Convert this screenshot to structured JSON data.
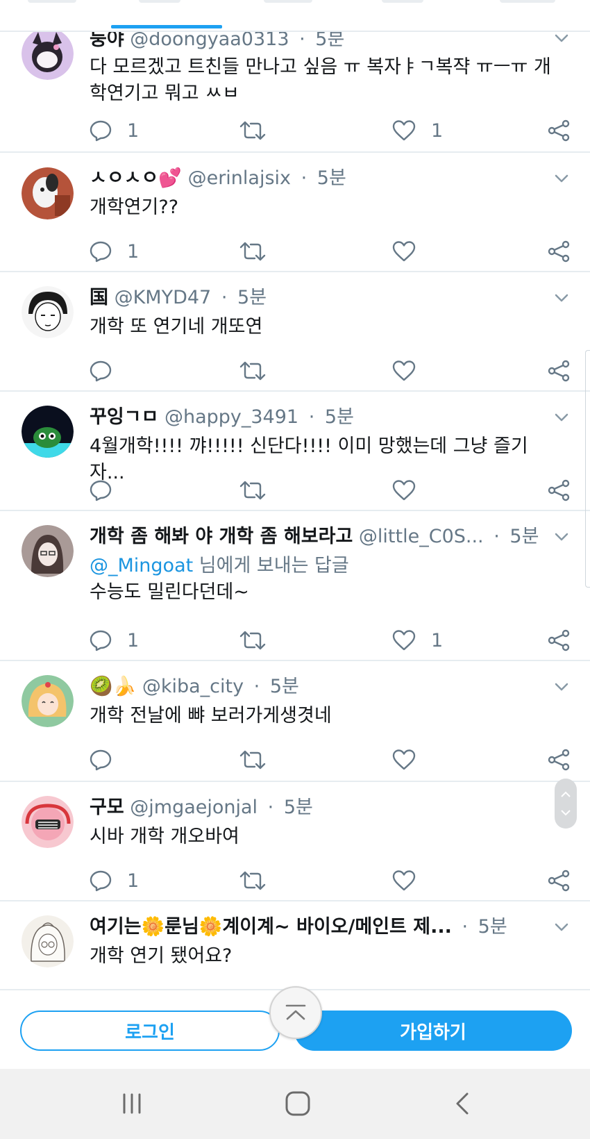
{
  "tweets": [
    {
      "display_name": "둥야",
      "handle": "@doongyaa0313",
      "time": "5분",
      "text_lines": [
        "다 모르겠고 트친들 만나고 싶음 ㅠ 복자ㅑㄱ복쟉 ㅠㅡㅠ 개",
        "학연기고 뭐고 ㅆㅂ"
      ],
      "reply_count": "1",
      "like_count": "1",
      "avatar_colors": [
        "#c9a6df",
        "#2a2a2a"
      ]
    },
    {
      "display_name": "ㅅㅇㅅㅇ💕",
      "handle": "@erinlajsix",
      "time": "5분",
      "text_lines": [
        "개학연기??"
      ],
      "reply_count": "1",
      "like_count": "",
      "avatar_colors": [
        "#b5533a",
        "#f2f2f2"
      ]
    },
    {
      "display_name": "国",
      "handle": "@KMYD47",
      "time": "5분",
      "text_lines": [
        "개학 또 연기네 개또연"
      ],
      "reply_count": "",
      "like_count": "",
      "avatar_colors": [
        "#f5f5f5",
        "#1a1a1a"
      ]
    },
    {
      "display_name": "꾸잉ㄱㅁ",
      "handle": "@happy_3491",
      "time": "5분",
      "text_lines": [
        "4월개학!!!! 꺄!!!!! 신단다!!!! 이미 망했는데 그냥 즐기자..."
      ],
      "reply_count": "",
      "like_count": "",
      "avatar_colors": [
        "#0a0f1e",
        "#3fd9e8"
      ]
    },
    {
      "display_name": "개학 좀 해봐 야 개학 좀 해보라고",
      "handle": "@little_C0S...",
      "time": "5분",
      "reply_prefix": "@_Mingoat",
      "reply_suffix": " 님에게 보내는 답글",
      "text_lines": [
        "수능도 밀린다던데~"
      ],
      "reply_count": "1",
      "like_count": "1",
      "avatar_colors": [
        "#a08f8c",
        "#4a3a38"
      ]
    },
    {
      "display_name": "🥝🍌",
      "handle": "@kiba_city",
      "time": "5분",
      "text_lines": [
        "개학 전날에 뺘 보러가게생겻네"
      ],
      "reply_count": "",
      "like_count": "",
      "avatar_colors": [
        "#8fc9a0",
        "#f4c36b"
      ]
    },
    {
      "display_name": "구모",
      "handle": "@jmgaejonjal",
      "time": "5분",
      "text_lines": [
        "시바 개학 개오바여"
      ],
      "reply_count": "1",
      "like_count": "",
      "avatar_colors": [
        "#f7c8d0",
        "#d8363c"
      ]
    },
    {
      "display_name": "여기는🌼룬님🌼계이계~ 바이오/메인트 제...",
      "handle": "",
      "time": "5분",
      "text_lines": [
        "개학 연기 됐어요?"
      ],
      "reply_count": "",
      "like_count": "",
      "avatar_colors": [
        "#f3f0ea",
        "#6d6660"
      ]
    }
  ],
  "bottom_bar": {
    "login_label": "로그인",
    "signup_label": "가입하기"
  },
  "colors": {
    "accent": "#1da1f2",
    "mention": "#1b95e0",
    "muted": "#657786",
    "divider": "#e6ecf0"
  },
  "icons": [
    "reply-icon",
    "retweet-icon",
    "like-icon",
    "share-icon",
    "chevron-down-icon",
    "scroll-to-top-icon",
    "recent-apps-icon",
    "home-icon",
    "back-icon"
  ]
}
